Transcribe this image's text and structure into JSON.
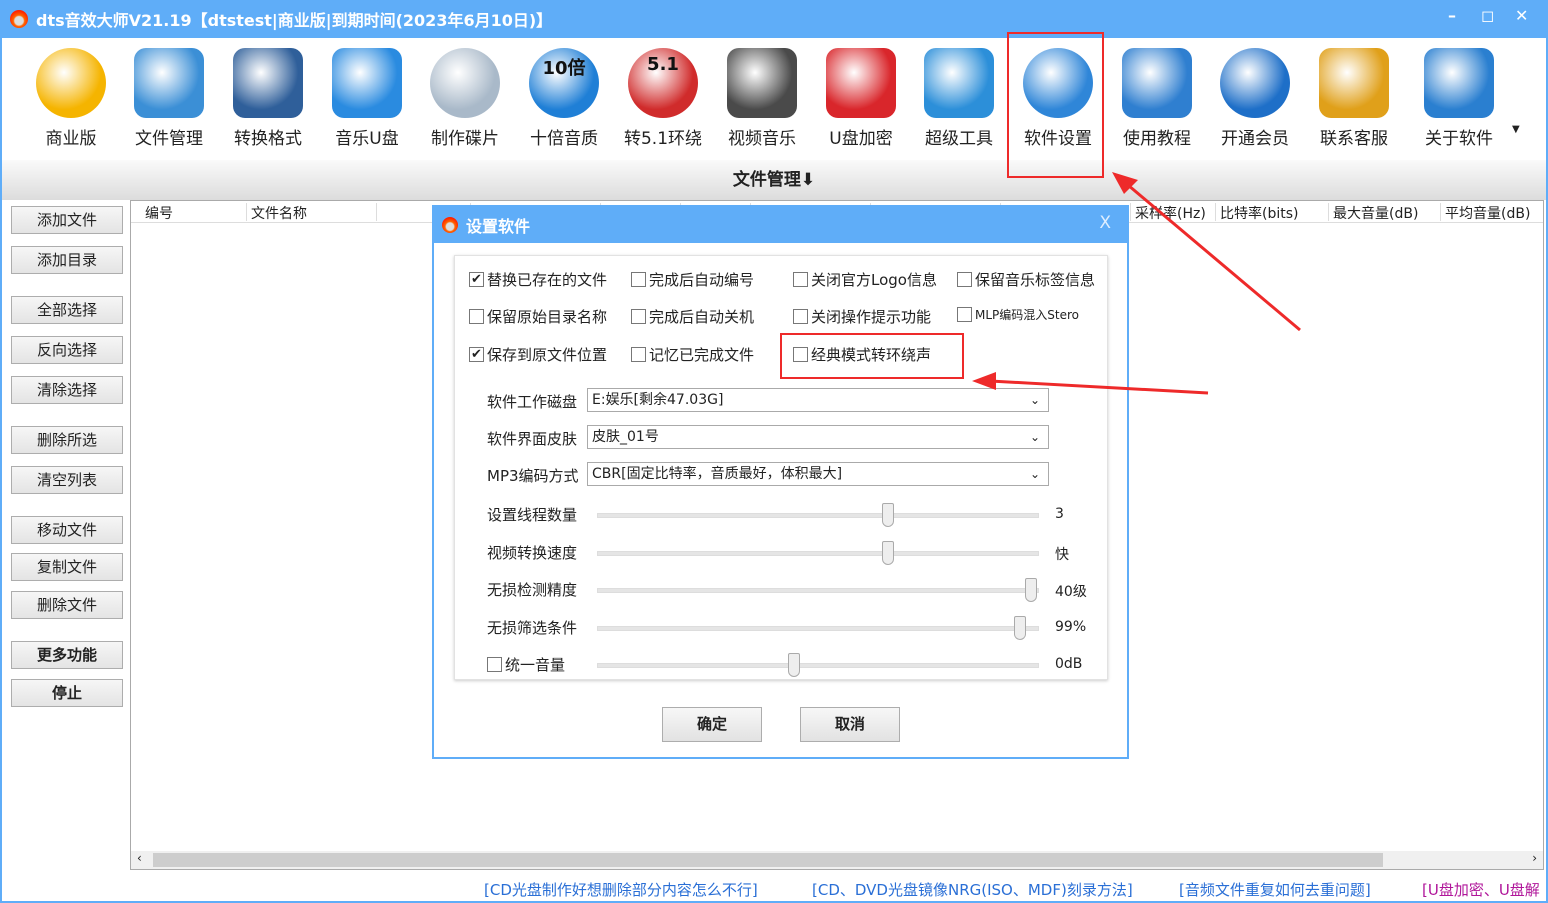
{
  "window": {
    "title": "dts音效大师V21.19【dtstest|商业版|到期时间(2023年6月10日)】",
    "minimize": "–",
    "maximize": "◻",
    "close": "✕"
  },
  "toolbar": [
    {
      "label": "商业版",
      "icon": "vip-icon",
      "color": "#f5b400"
    },
    {
      "label": "文件管理",
      "icon": "file-manager-icon",
      "color": "#3b8fd6"
    },
    {
      "label": "转换格式",
      "icon": "music-note-icon",
      "color": "#2f5f9a"
    },
    {
      "label": "音乐U盘",
      "icon": "usb-drive-icon",
      "color": "#2a8be0"
    },
    {
      "label": "制作碟片",
      "icon": "disc-icon",
      "color": "#a9b9c9"
    },
    {
      "label": "十倍音质",
      "icon": "10x-quality-icon",
      "color": "#1f7fd6",
      "badge": "10倍"
    },
    {
      "label": "转5.1环绕",
      "icon": "surround-5-1-icon",
      "color": "#d02b2b",
      "badge": "5.1"
    },
    {
      "label": "视频音乐",
      "icon": "video-clapper-icon",
      "color": "#4a4a4a"
    },
    {
      "label": "U盘加密",
      "icon": "usb-lock-icon",
      "color": "#d9262b"
    },
    {
      "label": "超级工具",
      "icon": "tools-icon",
      "color": "#2c8fd9"
    },
    {
      "label": "软件设置",
      "icon": "gear-icon",
      "color": "#2f86d8"
    },
    {
      "label": "使用教程",
      "icon": "help-icon",
      "color": "#2f7fd0"
    },
    {
      "label": "开通会员",
      "icon": "shop-cart-icon",
      "color": "#1e6fc8"
    },
    {
      "label": "联系客服",
      "icon": "customer-service-icon",
      "color": "#e0a01a"
    },
    {
      "label": "关于软件",
      "icon": "about-computer-icon",
      "color": "#2a7fd0"
    }
  ],
  "section": {
    "title": "文件管理⬇"
  },
  "left_buttons": [
    "添加文件",
    "添加目录",
    "全部选择",
    "反向选择",
    "清除选择",
    "删除所选",
    "清空列表",
    "移动文件",
    "复制文件",
    "删除文件",
    "更多功能",
    "停止"
  ],
  "table": {
    "columns": [
      "编号",
      "文件名称",
      "",
      "",
      "",
      "",
      "",
      "",
      "",
      "采样率(Hz)",
      "比特率(bits)",
      "最大音量(dB)",
      "平均音量(dB)"
    ]
  },
  "footer_links": [
    {
      "text": "[CD光盘制作好想删除部分内容怎么不行]",
      "color": "#2a6fd6"
    },
    {
      "text": "[CD、DVD光盘镜像NRG(ISO、MDF)刻录方法]",
      "color": "#2a6fd6"
    },
    {
      "text": "[音频文件重复如何去重问题]",
      "color": "#2a6fd6"
    },
    {
      "text": "[U盘加密、U盘解",
      "color": "#b0169a"
    }
  ],
  "dialog": {
    "title": "设置软件",
    "close": "X",
    "checkboxes": [
      {
        "label": "替换已存在的文件",
        "checked": true
      },
      {
        "label": "完成后自动编号",
        "checked": false
      },
      {
        "label": "关闭官方Logo信息",
        "checked": false
      },
      {
        "label": "保留音乐标签信息",
        "checked": false
      },
      {
        "label": "保留原始目录名称",
        "checked": false
      },
      {
        "label": "完成后自动关机",
        "checked": false
      },
      {
        "label": "关闭操作提示功能",
        "checked": false
      },
      {
        "label": "MLP编码混入Stero",
        "checked": false
      },
      {
        "label": "保存到原文件位置",
        "checked": true
      },
      {
        "label": "记忆已完成文件",
        "checked": false
      },
      {
        "label": "经典模式转环绕声",
        "checked": false
      }
    ],
    "selects": [
      {
        "label": "软件工作磁盘",
        "value": "E:娱乐[剩余47.03G]"
      },
      {
        "label": "软件界面皮肤",
        "value": "皮肤_01号"
      },
      {
        "label": "MP3编码方式",
        "value": "CBR[固定比特率，音质最好，体积最大]"
      }
    ],
    "sliders": [
      {
        "label": "设置线程数量",
        "value": "3",
        "level": 0.66
      },
      {
        "label": "视频转换速度",
        "value": "快",
        "level": 0.66
      },
      {
        "label": "无损检测精度",
        "value": "40级",
        "level": 0.985
      },
      {
        "label": "无损筛选条件",
        "value": "99%",
        "level": 0.96
      },
      {
        "label": "统一音量",
        "value": "0dB",
        "level": 0.445,
        "checkbox": true,
        "checked": false
      }
    ],
    "ok": "确定",
    "cancel": "取消"
  },
  "annotation_color": "#ee2a2a"
}
